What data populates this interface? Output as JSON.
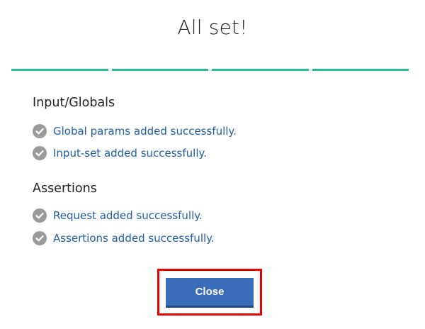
{
  "dialog": {
    "title": "All set!",
    "progress": {
      "total_steps": 4,
      "completed_steps": 4,
      "color": "#2eb892"
    },
    "sections": [
      {
        "heading": "Input/Globals",
        "items": [
          {
            "text": "Global params added successfully.",
            "icon": "check-circle-icon",
            "status": "success"
          },
          {
            "text": "Input-set added successfully.",
            "icon": "check-circle-icon",
            "status": "success"
          }
        ]
      },
      {
        "heading": "Assertions",
        "items": [
          {
            "text": "Request added successfully.",
            "icon": "check-circle-icon",
            "status": "success"
          },
          {
            "text": "Assertions added successfully.",
            "icon": "check-circle-icon",
            "status": "success"
          }
        ]
      }
    ],
    "close_label": "Close",
    "colors": {
      "accent": "#3a6db8",
      "link_text": "#1f5ea8",
      "check_icon": "#9a9a9a",
      "highlight": "#e60000"
    }
  }
}
